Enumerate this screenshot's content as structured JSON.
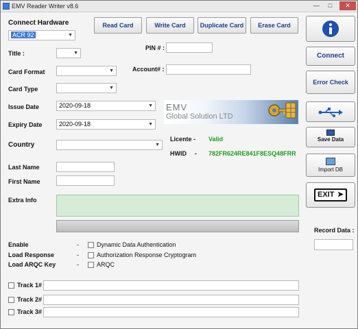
{
  "window": {
    "title": "EMV Reader Writer v8.6"
  },
  "hardware": {
    "label": "Connect Hardware",
    "value": "ACR 92"
  },
  "toolbar": {
    "read_label": "Read Card",
    "write_label": "Write Card",
    "duplicate_label": "Duplicate Card",
    "erase_label": "Erase Card"
  },
  "form": {
    "title_label": "Title :",
    "pin_label": "PIN # :",
    "card_format_label": "Card Format",
    "account_label": "Account# :",
    "card_type_label": "Card Type",
    "issue_date_label": "Issue Date",
    "issue_date_value": "2020-09-18",
    "expiry_date_label": "Expiry Date",
    "expiry_date_value": "2020-09-18",
    "country_label": "Country",
    "last_name_label": "Last Name",
    "first_name_label": "First Name",
    "extra_info_label": "Extra Info"
  },
  "banner": {
    "line1": "EMV",
    "line2": "Global Solution LTD"
  },
  "license": {
    "licente_label": "Licente -",
    "licente_value": "Valid",
    "hwid_label": "HWID",
    "hwid_dash": "-",
    "hwid_value": "782FR624RE841F8ESQ48FRR"
  },
  "sidebar": {
    "connect_label": "Connect",
    "error_check_label": "Error Check",
    "save_data_label": "Save Data",
    "import_db_label": "Import DB",
    "exit_label": "EXIT",
    "record_data_label": "Record Data :"
  },
  "options": {
    "enable_label": "Enable",
    "load_response_label": "Load Response",
    "load_arqc_label": "Load ARQC Key",
    "dash": "-",
    "dda_label": "Dynamic Data Authentication",
    "arc_label": "Authorization Response Cryptogram",
    "arqc_label": "ARQC"
  },
  "tracks": {
    "track1_label": "Track 1#",
    "track2_label": "Track 2#",
    "track3_label": "Track 3#"
  },
  "colors": {
    "accent": "#1f3e88",
    "valid": "#1e9b1e",
    "extra_info_bg": "#d6ecd6"
  }
}
